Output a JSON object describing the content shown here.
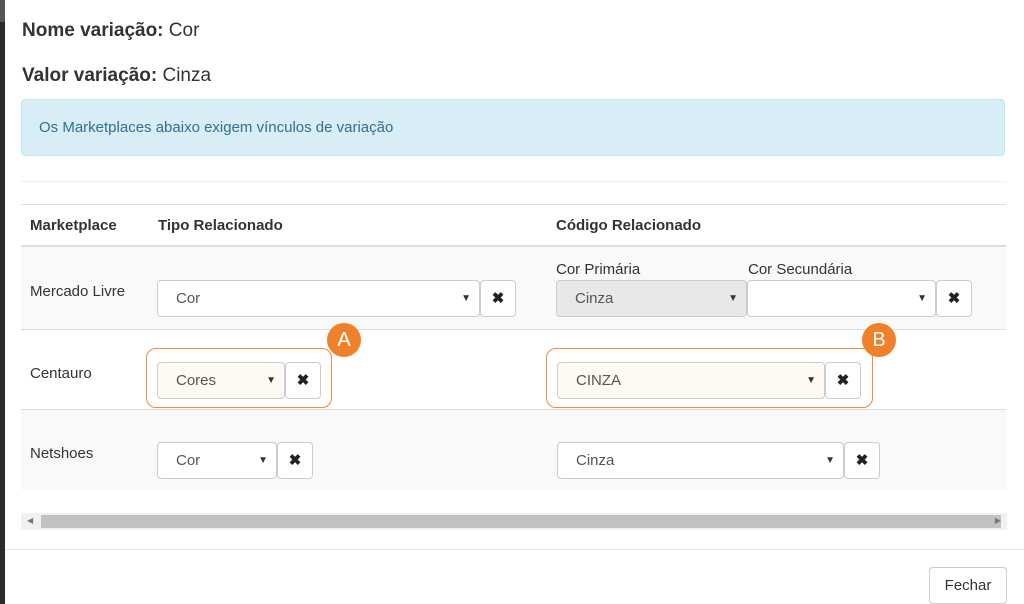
{
  "header": {
    "nome_label": "Nome variação:",
    "nome_value": "Cor",
    "valor_label": "Valor variação:",
    "valor_value": "Cinza"
  },
  "alert": {
    "text": "Os Marketplaces abaixo exigem vínculos de variação"
  },
  "table": {
    "columns": [
      "Marketplace",
      "Tipo Relacionado",
      "Código Relacionado"
    ],
    "rows": [
      {
        "marketplace": "Mercado Livre",
        "tipo": "Cor",
        "primaria_label": "Cor Primária",
        "primaria_value": "Cinza",
        "secundaria_label": "Cor Secundária",
        "secundaria_value": ""
      },
      {
        "marketplace": "Centauro",
        "tipo": "Cores",
        "codigo": "CINZA"
      },
      {
        "marketplace": "Netshoes",
        "tipo": "Cor",
        "codigo": "Cinza"
      }
    ]
  },
  "annotations": {
    "a": "A",
    "b": "B"
  },
  "icons": {
    "remove": "✖",
    "caret": "▼",
    "scroll_left": "◀",
    "scroll_right": "▶"
  },
  "footer": {
    "close_label": "Fechar"
  },
  "colors": {
    "highlight": "#f0802a",
    "alert_bg": "#d9edf7",
    "alert_text": "#31708f"
  }
}
